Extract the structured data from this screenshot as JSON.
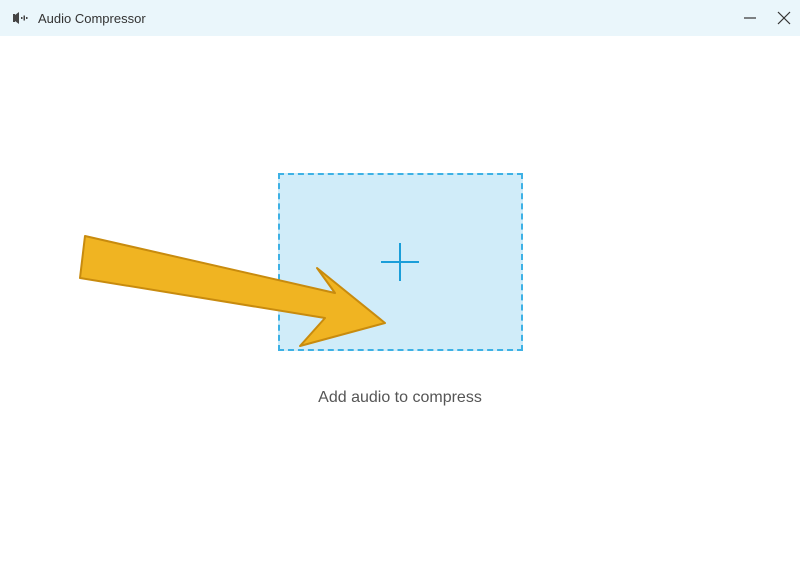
{
  "titlebar": {
    "title": "Audio Compressor"
  },
  "main": {
    "caption": "Add audio to compress"
  },
  "colors": {
    "titlebar_bg": "#eaf6fb",
    "dropzone_bg": "#d0ecf9",
    "dropzone_border": "#3db1e5",
    "plus_color": "#1a9ed9",
    "arrow_fill": "#f0b422",
    "arrow_stroke": "#c88b0e"
  }
}
